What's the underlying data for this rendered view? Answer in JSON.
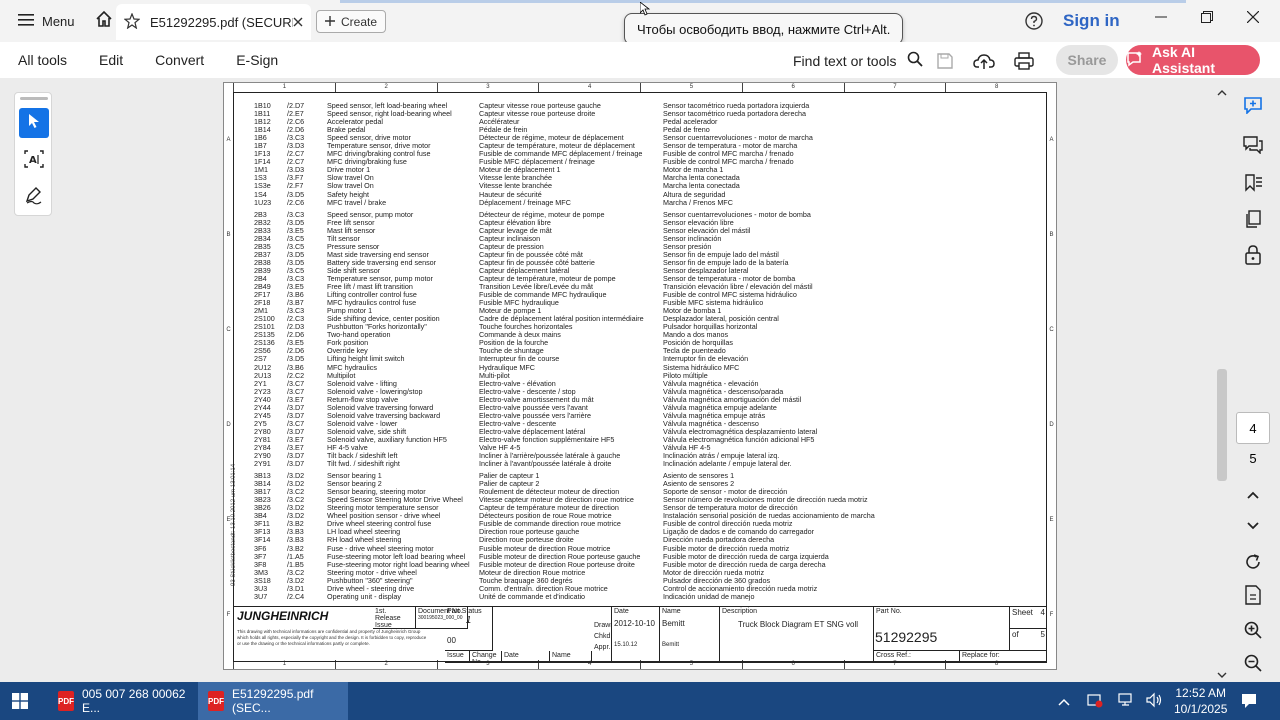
{
  "titlebar": {
    "menu_label": "Menu",
    "tab_title": "E51292295.pdf (SECURE...",
    "create_label": "Create",
    "tooltip": "Чтобы освободить ввод, нажмите Ctrl+Alt.",
    "signin": "Sign in"
  },
  "toolbar": {
    "items": [
      "All tools",
      "Edit",
      "Convert",
      "E-Sign"
    ],
    "find_label": "Find text or tools",
    "share_label": "Share",
    "ai_label": "Ask AI Assistant"
  },
  "document": {
    "ruler_numbers": [
      "1",
      "2",
      "3",
      "4",
      "5",
      "6",
      "7",
      "8"
    ],
    "ruler_letters": [
      "A",
      "B",
      "C",
      "D",
      "E",
      "F"
    ],
    "side_note": "93 Stücklistbestandt: 13.10.2012 um 13:01:14",
    "rows": [
      [
        "1B10",
        "/2.D7",
        "Speed sensor, left load-bearing wheel",
        "Capteur vitesse roue porteuse gauche",
        "Sensor tacométrico rueda portadora izquierda"
      ],
      [
        "1B11",
        "/2.E7",
        "Speed sensor, right load-bearing wheel",
        "Capteur vitesse roue porteuse droite",
        "Sensor tacométrico rueda portadora derecha"
      ],
      [
        "1B12",
        "/2.C6",
        "Accelerator pedal",
        "Accélérateur",
        "Pedal acelerador"
      ],
      [
        "1B14",
        "/2.D6",
        "Brake pedal",
        "Pédale de frein",
        "Pedal de freno"
      ],
      [
        "1B6",
        "/3.C3",
        "Speed sensor, drive motor",
        "Détecteur de régime, moteur de déplacement",
        "Sensor cuentarrevoluciones - motor de marcha"
      ],
      [
        "1B7",
        "/3.D3",
        "Temperature sensor, drive motor",
        "Capteur de température, moteur de déplacement",
        "Sensor de temperatura - motor de marcha"
      ],
      [
        "1F13",
        "/2.C7",
        "MFC driving/braking control fuse",
        "Fusible de commande MFC déplacement / freinage",
        "Fusible de control MFC marcha / frenado"
      ],
      [
        "1F14",
        "/2.C7",
        "MFC driving/braking fuse",
        "Fusible MFC déplacement / freinage",
        "Fusible de control MFC marcha / frenado"
      ],
      [
        "1M1",
        "/3.D3",
        "Drive motor 1",
        "Moteur de déplacement 1",
        "Motor de marcha 1"
      ],
      [
        "1S3",
        "/3.F7",
        "Slow travel On",
        "Vitesse lente branchée",
        "Marcha lenta conectada"
      ],
      [
        "1S3e",
        "/2.F7",
        "Slow travel On",
        "Vitesse lente branchée",
        "Marcha lenta conectada"
      ],
      [
        "1S4",
        "/3.D5",
        "Safety height",
        "Hauteur de sécurité",
        "Altura de seguridad"
      ],
      [
        "1U23",
        "/2.C6",
        "MFC travel / brake",
        "Déplacement / freinage MFC",
        "Marcha / Frenos MFC"
      ],
      [
        "",
        "",
        "",
        "",
        ""
      ],
      [
        "2B3",
        "/3.C3",
        "Speed sensor, pump motor",
        "Détecteur de régime, moteur de pompe",
        "Sensor cuentarrevoluciones - motor de bomba"
      ],
      [
        "2B32",
        "/3.D5",
        "Free lift sensor",
        "Capteur élévation libre",
        "Sensor elevación libre"
      ],
      [
        "2B33",
        "/3.E5",
        "Mast lift sensor",
        "Capteur levage de mât",
        "Sensor elevación del mástil"
      ],
      [
        "2B34",
        "/3.C5",
        "Tilt sensor",
        "Capteur inclinaison",
        "Sensor inclinación"
      ],
      [
        "2B35",
        "/3.C5",
        "Pressure sensor",
        "Capteur de pression",
        "Sensor presión"
      ],
      [
        "2B37",
        "/3.D5",
        "Mast side traversing end sensor",
        "Capteur fin de poussée côté mât",
        "Sensor fin de empuje lado del mástil"
      ],
      [
        "2B38",
        "/3.D5",
        "Battery side traversing end sensor",
        "Capteur fin de poussée côté batterie",
        "Sensor fin de empuje lado de la batería"
      ],
      [
        "2B39",
        "/3.C5",
        "Side shift sensor",
        "Capteur déplacement latéral",
        "Sensor desplazador lateral"
      ],
      [
        "2B4",
        "/3.C3",
        "Temperature sensor, pump motor",
        "Capteur de température, moteur de pompe",
        "Sensor de temperatura - motor de bomba"
      ],
      [
        "2B49",
        "/3.E5",
        "Free lift / mast lift transition",
        "Transition Levée libre/Levée du mât",
        "Transición elevación libre / elevación del mástil"
      ],
      [
        "2F17",
        "/3.B6",
        "Lifting controller control fuse",
        "Fusible de commande MFC hydraulique",
        "Fusible de control MFC sistema hidráulico"
      ],
      [
        "2F18",
        "/3.B7",
        "MFC hydraulics control fuse",
        "Fusible MFC hydraulique",
        "Fusible MFC sistema hidráulico"
      ],
      [
        "2M1",
        "/3.C3",
        "Pump motor 1",
        "Moteur de pompe 1",
        "Motor de bomba 1"
      ],
      [
        "2S100",
        "/2.C3",
        "Side shifting device, center position",
        "Cadre de déplacement latéral position intermédiaire",
        "Desplazador lateral, posición central"
      ],
      [
        "2S101",
        "/2.D3",
        "Pushbutton \"Forks horizontally\"",
        "Touche fourches horizontales",
        "Pulsador horquillas horizontal"
      ],
      [
        "2S135",
        "/2.D6",
        "Two-hand operation",
        "Commande à deux mains",
        "Mando a dos manos"
      ],
      [
        "2S136",
        "/3.E5",
        "Fork position",
        "Position de la fourche",
        "Posición de horquillas"
      ],
      [
        "2S56",
        "/2.D6",
        "Override key",
        "Touche de shuntage",
        "Tecla de puenteado"
      ],
      [
        "2S7",
        "/3.D5",
        "Lifting height limit switch",
        "Interrupteur fin de course",
        "Interruptor fin de elevación"
      ],
      [
        "2U12",
        "/3.B6",
        "MFC hydraulics",
        "Hydraulique MFC",
        "Sistema hidráulico MFC"
      ],
      [
        "2U13",
        "/2.C2",
        "Multipilot",
        "Multi-pilot",
        "Piloto múltiple"
      ],
      [
        "2Y1",
        "/3.C7",
        "Solenoid valve - lifting",
        "Electro-valve - élévation",
        "Válvula magnética - elevación"
      ],
      [
        "2Y23",
        "/3.C7",
        "Solenoid valve - lowering/stop",
        "Electro-valve - descente / stop",
        "Válvula magnética - descenso/parada"
      ],
      [
        "2Y40",
        "/3.E7",
        "Return-flow stop valve",
        "Electro-valve amortissement du mât",
        "Válvula magnética amortiguación del mástil"
      ],
      [
        "2Y44",
        "/3.D7",
        "Solenoid valve traversing forward",
        "Electro-valve poussée vers l'avant",
        "Válvula magnética empuje adelante"
      ],
      [
        "2Y45",
        "/3.D7",
        "Solenoid valve traversing backward",
        "Electro-valve poussée vers l'arrière",
        "Válvula magnética empuje atrás"
      ],
      [
        "2Y5",
        "/3.C7",
        "Solenoid valve - lower",
        "Electro-valve - descente",
        "Válvula magnética - descenso"
      ],
      [
        "2Y80",
        "/3.D7",
        "Solenoid valve, side shift",
        "Electro-valve déplacement latéral",
        "Válvula electromagnética desplazamiento lateral"
      ],
      [
        "2Y81",
        "/3.E7",
        "Solenoid valve, auxiliary function HF5",
        "Electro-valve fonction supplémentaire HF5",
        "Válvula electromagnética función adicional HF5"
      ],
      [
        "2Y84",
        "/3.E7",
        "HF 4-5 valve",
        "Valve HF 4-5",
        "Válvula HF 4-5"
      ],
      [
        "2Y90",
        "/3.D7",
        "Tilt back / sideshift left",
        "Incliner à l'arrière/poussée latérale à gauche",
        "Inclinación atrás / empuje lateral izq."
      ],
      [
        "2Y91",
        "/3.D7",
        "Tilt fwd. / sideshift right",
        "Incliner à l'avant/poussée latérale à droite",
        "Inclinación adelante / empuje lateral der."
      ],
      [
        "",
        "",
        "",
        "",
        ""
      ],
      [
        "3B13",
        "/3.D2",
        "Sensor bearing 1",
        "Palier de capteur 1",
        "Asiento de sensores 1"
      ],
      [
        "3B14",
        "/3.D2",
        "Sensor bearing 2",
        "Palier de capteur 2",
        "Asiento de sensores 2"
      ],
      [
        "3B17",
        "/3.C2",
        "Sensor bearing, steering motor",
        "Roulement de détecteur moteur de direction",
        "Soporte de sensor - motor de dirección"
      ],
      [
        "3B23",
        "/3.C2",
        "Speed Sensor Steering Motor Drive Wheel",
        "Vitesse capteur moteur de direction roue motrice",
        "Sensor número de revoluciones motor de dirección rueda motriz"
      ],
      [
        "3B26",
        "/3.D2",
        "Steering motor temperature sensor",
        "Capteur de température moteur de direction",
        "Sensor de temperatura motor de dirección"
      ],
      [
        "3B4",
        "/3.D2",
        "Wheel position sensor - drive wheel",
        "Détecteurs position de roue Roue motrice",
        "Instalación sensorial posición de ruedas accionamiento de marcha"
      ],
      [
        "3F11",
        "/3.B2",
        "Drive wheel steering control fuse",
        "Fusible de commande direction roue motrice",
        "Fusible de control dirección rueda motriz"
      ],
      [
        "3F13",
        "/3.B3",
        "LH load wheel steering",
        "Direction roue porteuse gauche",
        "Ligação de dados e de comando do carregador"
      ],
      [
        "3F14",
        "/3.B3",
        "RH load wheel steering",
        "Direction roue porteuse droite",
        "Dirección rueda portadora derecha"
      ],
      [
        "3F6",
        "/3.B2",
        "Fuse - drive wheel steering motor",
        "Fusible moteur de direction Roue motrice",
        "Fusible motor de dirección rueda motriz"
      ],
      [
        "3F7",
        "/1.A5",
        "Fuse-steering motor left load bearing wheel",
        "Fusible moteur de direction Roue porteuse gauche",
        "Fusible motor de dirección rueda de carga izquierda"
      ],
      [
        "3F8",
        "/1.B5",
        "Fuse-steering motor right load bearing wheel",
        "Fusible moteur de direction Roue porteuse droite",
        "Fusible motor de dirección rueda de carga derecha"
      ],
      [
        "3M3",
        "/3.C2",
        "Steering motor - drive wheel",
        "Moteur de direction Roue motrice",
        "Motor de dirección rueda motriz"
      ],
      [
        "3S18",
        "/3.D2",
        "Pushbutton \"360\" steering\"",
        "Touche braquage 360 degrés",
        "Pulsador dirección de 360 grados"
      ],
      [
        "3U3",
        "/3.D1",
        "Drive wheel - steering drive",
        "Comm. d'entraîn. direction Roue motrice",
        "Control de accionamiento dirección rueda motriz"
      ],
      [
        "3U7",
        "/2.C4",
        "Operating unit - display",
        "Unité de commande et d'indicatio",
        "Indicación unidad de manejo"
      ]
    ],
    "titleblock": {
      "brand": "JUNGHEINRICH",
      "release_issue_label": "1st. Release Issue",
      "release_issue": "00",
      "doc_no_label": "Document No.",
      "doc_no": "300195023_000_00",
      "part_status_label": "Part Status",
      "part_status": "1",
      "date_label": "Date",
      "name_label": "Name",
      "drawn_label": "Drawn.",
      "drawn_date": "2012-10-10",
      "drawn_name": "Bemitt",
      "chkd_label": "Chkd.",
      "appr_label": "Appr.",
      "appr_date": "15.10.12",
      "appr_name": "Bemitt",
      "issue_label": "Issue",
      "issue": "00",
      "change_no_label": "Change No.",
      "desc_label": "Description",
      "description": "Truck Block Diagram ET SNG voll",
      "partno_label": "Part No.",
      "partno": "51292295",
      "sheet_label": "Sheet",
      "sheet": "4",
      "of_label": "of",
      "of": "5",
      "crossref_label": "Cross Ref.:",
      "replace_label": "Replace for:",
      "disclaimer": "This drawing with technical informations are confidential and property of Jungheinrich Group which holds all rights, especially the copyright and the design. It is forbidden to copy, reproduce or use the drawing or the technical informations partly or complete."
    }
  },
  "pager": {
    "current": "4",
    "total": "5"
  },
  "taskbar": {
    "apps": [
      "005 007 268 00062 E...",
      "E51292295.pdf (SEC..."
    ],
    "time": "12:52 AM",
    "date": "10/1/2025"
  },
  "colors": {
    "accent": "#1473e6",
    "ai": "#e8546b",
    "signin": "#2f66c4",
    "taskbar": "#1a4780"
  }
}
